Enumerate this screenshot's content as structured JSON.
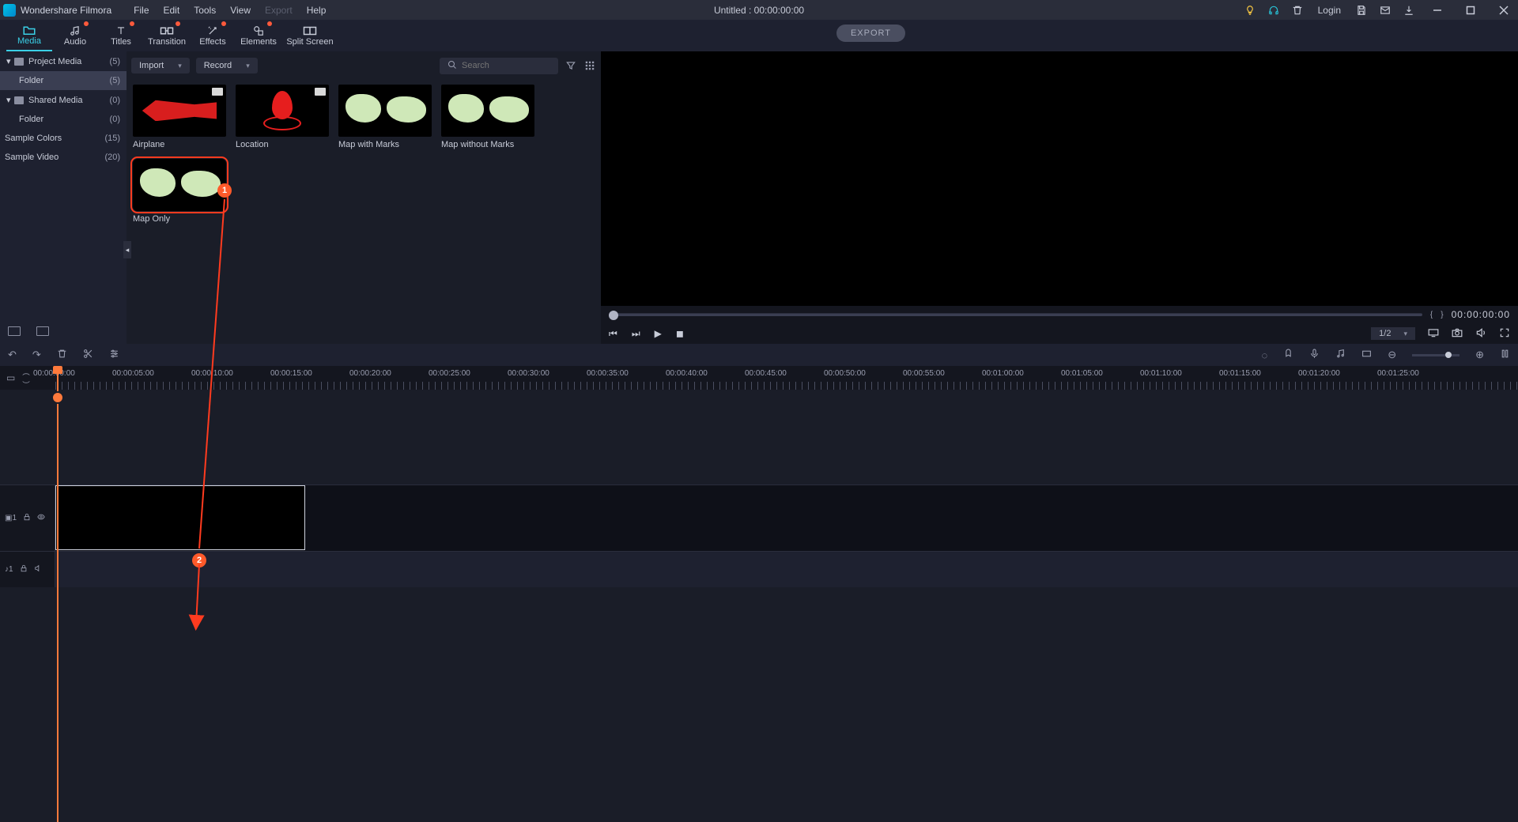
{
  "app": {
    "brand": "Wondershare Filmora",
    "doc_title": "Untitled : 00:00:00:00"
  },
  "menu": {
    "file": "File",
    "edit": "Edit",
    "tools": "Tools",
    "view": "View",
    "export": "Export",
    "help": "Help"
  },
  "titlebar_right": {
    "login": "Login"
  },
  "modules": {
    "media": "Media",
    "audio": "Audio",
    "titles": "Titles",
    "transition": "Transition",
    "effects": "Effects",
    "elements": "Elements",
    "splitscreen": "Split Screen"
  },
  "export_btn": "EXPORT",
  "sidebar": {
    "items": [
      {
        "label": "Project Media",
        "count": "(5)",
        "expandable": true
      },
      {
        "label": "Folder",
        "count": "(5)",
        "sub": true,
        "selected": true
      },
      {
        "label": "Shared Media",
        "count": "(0)",
        "expandable": true
      },
      {
        "label": "Folder",
        "count": "(0)",
        "sub": true
      },
      {
        "label": "Sample Colors",
        "count": "(15)"
      },
      {
        "label": "Sample Video",
        "count": "(20)"
      }
    ]
  },
  "mid": {
    "import": "Import",
    "record": "Record",
    "search_placeholder": "Search"
  },
  "media_items": [
    {
      "label": "Airplane",
      "kind": "airplane"
    },
    {
      "label": "Location",
      "kind": "location"
    },
    {
      "label": "Map with Marks",
      "kind": "map"
    },
    {
      "label": "Map without Marks",
      "kind": "map"
    },
    {
      "label": "Map Only",
      "kind": "map",
      "selected": true
    }
  ],
  "preview": {
    "timecode": "00:00:00:00",
    "ratio": "1/2"
  },
  "ruler_labels": [
    "00:00:00:00",
    "00:00:05:00",
    "00:00:10:00",
    "00:00:15:00",
    "00:00:20:00",
    "00:00:25:00",
    "00:00:30:00",
    "00:00:35:00",
    "00:00:40:00",
    "00:00:45:00",
    "00:00:50:00",
    "00:00:55:00",
    "00:01:00:00",
    "00:01:05:00",
    "00:01:10:00",
    "00:01:15:00",
    "00:01:20:00",
    "00:01:25:00"
  ],
  "annotation": {
    "one": "1",
    "two": "2"
  }
}
